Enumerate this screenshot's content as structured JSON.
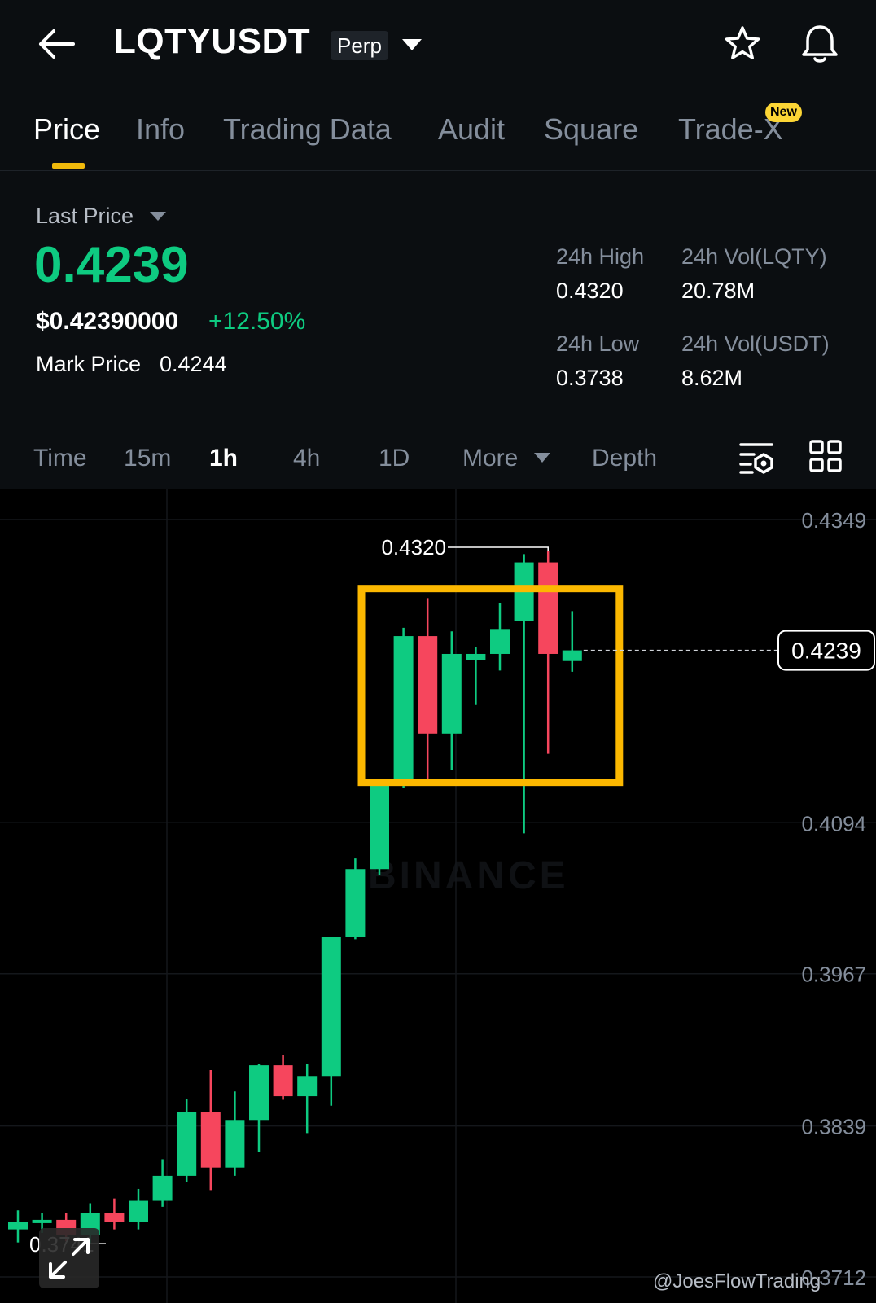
{
  "header": {
    "symbol": "LQTYUSDT",
    "contract_type": "Perp"
  },
  "tabs": [
    {
      "label": "Price",
      "active": true
    },
    {
      "label": "Info",
      "active": false
    },
    {
      "label": "Trading Data",
      "active": false
    },
    {
      "label": "Audit",
      "active": false
    },
    {
      "label": "Square",
      "active": false
    },
    {
      "label": "Trade-X",
      "active": false,
      "badge": "New"
    }
  ],
  "ticker": {
    "last_price_label": "Last Price",
    "last_price": "0.4239",
    "usd_price": "$0.42390000",
    "change_pct": "+12.50%",
    "mark_price_label": "Mark Price",
    "mark_price": "0.4244",
    "high_label": "24h High",
    "high": "0.4320",
    "low_label": "24h Low",
    "low": "0.3738",
    "vol_base_label": "24h Vol(LQTY)",
    "vol_base": "20.78M",
    "vol_quote_label": "24h Vol(USDT)",
    "vol_quote": "8.62M"
  },
  "intervals": {
    "items": [
      "Time",
      "15m",
      "1h",
      "4h",
      "1D",
      "More",
      "Depth"
    ],
    "active": "1h"
  },
  "colors": {
    "up": "#0ecb81",
    "down": "#f6465d",
    "accent": "#f0b90b",
    "highlight_box": "#fcb800"
  },
  "icons": [
    "back-arrow-icon",
    "caret-down-icon",
    "star-icon",
    "bell-icon",
    "chart-settings-icon",
    "grid-layout-icon",
    "expand-icon"
  ],
  "chart_data": {
    "type": "candlestick",
    "interval": "1h",
    "y_axis_ticks": [
      "0.4349",
      "0.4094",
      "0.3967",
      "0.3839",
      "0.3712"
    ],
    "ylim": [
      0.3712,
      0.4349
    ],
    "current_price_label": "0.4239",
    "high_annotation": "0.4320",
    "low_annotation": "0.3741",
    "watermark": "BINANCE",
    "candles": [
      {
        "o": 0.3752,
        "h": 0.3768,
        "l": 0.3741,
        "c": 0.3758
      },
      {
        "o": 0.3758,
        "h": 0.3766,
        "l": 0.3749,
        "c": 0.376
      },
      {
        "o": 0.376,
        "h": 0.3766,
        "l": 0.3742,
        "c": 0.3747
      },
      {
        "o": 0.3747,
        "h": 0.3774,
        "l": 0.374,
        "c": 0.3766
      },
      {
        "o": 0.3766,
        "h": 0.3778,
        "l": 0.3752,
        "c": 0.3758
      },
      {
        "o": 0.3758,
        "h": 0.3786,
        "l": 0.3752,
        "c": 0.3776
      },
      {
        "o": 0.3776,
        "h": 0.3811,
        "l": 0.3771,
        "c": 0.3797
      },
      {
        "o": 0.3797,
        "h": 0.3862,
        "l": 0.3792,
        "c": 0.3851
      },
      {
        "o": 0.3851,
        "h": 0.3886,
        "l": 0.3785,
        "c": 0.3804
      },
      {
        "o": 0.3804,
        "h": 0.3868,
        "l": 0.3797,
        "c": 0.3844
      },
      {
        "o": 0.3844,
        "h": 0.3891,
        "l": 0.3817,
        "c": 0.389
      },
      {
        "o": 0.389,
        "h": 0.3899,
        "l": 0.3861,
        "c": 0.3864
      },
      {
        "o": 0.3864,
        "h": 0.3891,
        "l": 0.3833,
        "c": 0.3881
      },
      {
        "o": 0.3881,
        "h": 0.3908,
        "l": 0.3856,
        "c": 0.3998
      },
      {
        "o": 0.3998,
        "h": 0.4064,
        "l": 0.3996,
        "c": 0.4055
      },
      {
        "o": 0.4055,
        "h": 0.4113,
        "l": 0.405,
        "c": 0.4129
      },
      {
        "o": 0.4129,
        "h": 0.4258,
        "l": 0.4123,
        "c": 0.4251
      },
      {
        "o": 0.4251,
        "h": 0.4283,
        "l": 0.4127,
        "c": 0.4169
      },
      {
        "o": 0.4169,
        "h": 0.4255,
        "l": 0.4138,
        "c": 0.4236
      },
      {
        "o": 0.4231,
        "h": 0.4242,
        "l": 0.4193,
        "c": 0.4236
      },
      {
        "o": 0.4236,
        "h": 0.4279,
        "l": 0.4222,
        "c": 0.4257
      },
      {
        "o": 0.4264,
        "h": 0.432,
        "l": 0.4085,
        "c": 0.4313
      },
      {
        "o": 0.4313,
        "h": 0.4323,
        "l": 0.4152,
        "c": 0.4236
      },
      {
        "o": 0.423,
        "h": 0.4272,
        "l": 0.4221,
        "c": 0.4239
      }
    ]
  },
  "credit": "@JoesFlowTrading"
}
